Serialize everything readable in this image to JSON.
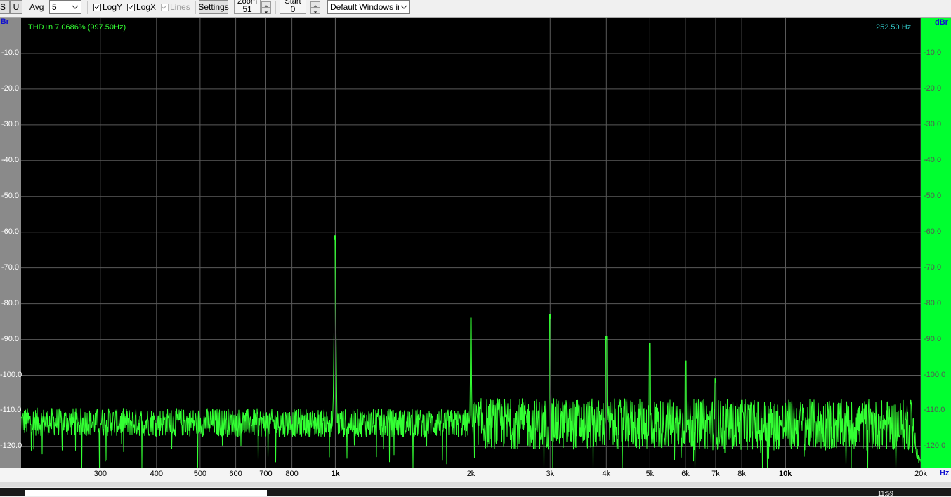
{
  "toolbar": {
    "btn_s": "S",
    "btn_u": "U",
    "avg_label": "Avg=",
    "avg_value": "5",
    "logy_label": "LogY",
    "logy_checked": true,
    "logx_label": "LogX",
    "logx_checked": true,
    "lines_label": "Lines",
    "lines_checked": true,
    "lines_enabled": false,
    "settings_label": "Settings",
    "zoom_label": "Zoom",
    "zoom_value": "51",
    "start_label": "Start",
    "start_value": "0",
    "window_select": "Default Windows inp"
  },
  "plot": {
    "thd_readout": "THD+n 7.0686% (997.50Hz)",
    "freq_readout": "252.50 Hz",
    "left_unit": "dBr",
    "right_unit": "dBr",
    "x_unit": "Hz",
    "colors": {
      "background": "#000000",
      "trace": "#33ff33",
      "grid": "#5a5a5a",
      "thd_text": "#33ff33",
      "freq_text": "#33cccc",
      "right_axis_bg": "#00ff30",
      "left_axis_bg": "#8a8a8a"
    }
  },
  "taskbar": {
    "clock": "11:59"
  },
  "chart_data": {
    "type": "line",
    "title": "",
    "xlabel": "Hz",
    "ylabel": "dBr",
    "x_scale": "log",
    "xlim": [
      200,
      20000
    ],
    "ylim": [
      -126,
      0
    ],
    "grid": true,
    "y_ticks": [
      "-10.0",
      "-20.0",
      "-30.0",
      "-40.0",
      "-50.0",
      "-60.0",
      "-70.0",
      "-80.0",
      "-90.0",
      "-100.0",
      "-110.0",
      "-120.0"
    ],
    "y_tick_values": [
      -10,
      -20,
      -30,
      -40,
      -50,
      -60,
      -70,
      -80,
      -90,
      -100,
      -110,
      -120
    ],
    "x_ticks": [
      "300",
      "400",
      "500",
      "600",
      "700",
      "800",
      "1k",
      "2k",
      "3k",
      "4k",
      "5k",
      "6k",
      "7k",
      "8k",
      "10k",
      "20k"
    ],
    "x_tick_values": [
      300,
      400,
      500,
      600,
      700,
      800,
      1000,
      2000,
      3000,
      4000,
      5000,
      6000,
      7000,
      8000,
      10000,
      20000
    ],
    "x_tick_bold": [
      false,
      false,
      false,
      false,
      false,
      false,
      true,
      false,
      false,
      false,
      false,
      false,
      false,
      false,
      true,
      false
    ],
    "noise_floor": {
      "low_freq_db": -113,
      "high_freq_db": -114,
      "variation_db": 4
    },
    "rolloff": {
      "start_hz": 19000,
      "end_hz": 20000,
      "end_db": -126
    },
    "peaks": [
      {
        "x": 997.5,
        "y": -61
      },
      {
        "x": 2000,
        "y": -84
      },
      {
        "x": 3000,
        "y": -83
      },
      {
        "x": 4000,
        "y": -89
      },
      {
        "x": 5000,
        "y": -91
      },
      {
        "x": 6000,
        "y": -96
      },
      {
        "x": 7000,
        "y": -101
      },
      {
        "x": 8000,
        "y": -107
      },
      {
        "x": 19000,
        "y": -107
      }
    ]
  }
}
